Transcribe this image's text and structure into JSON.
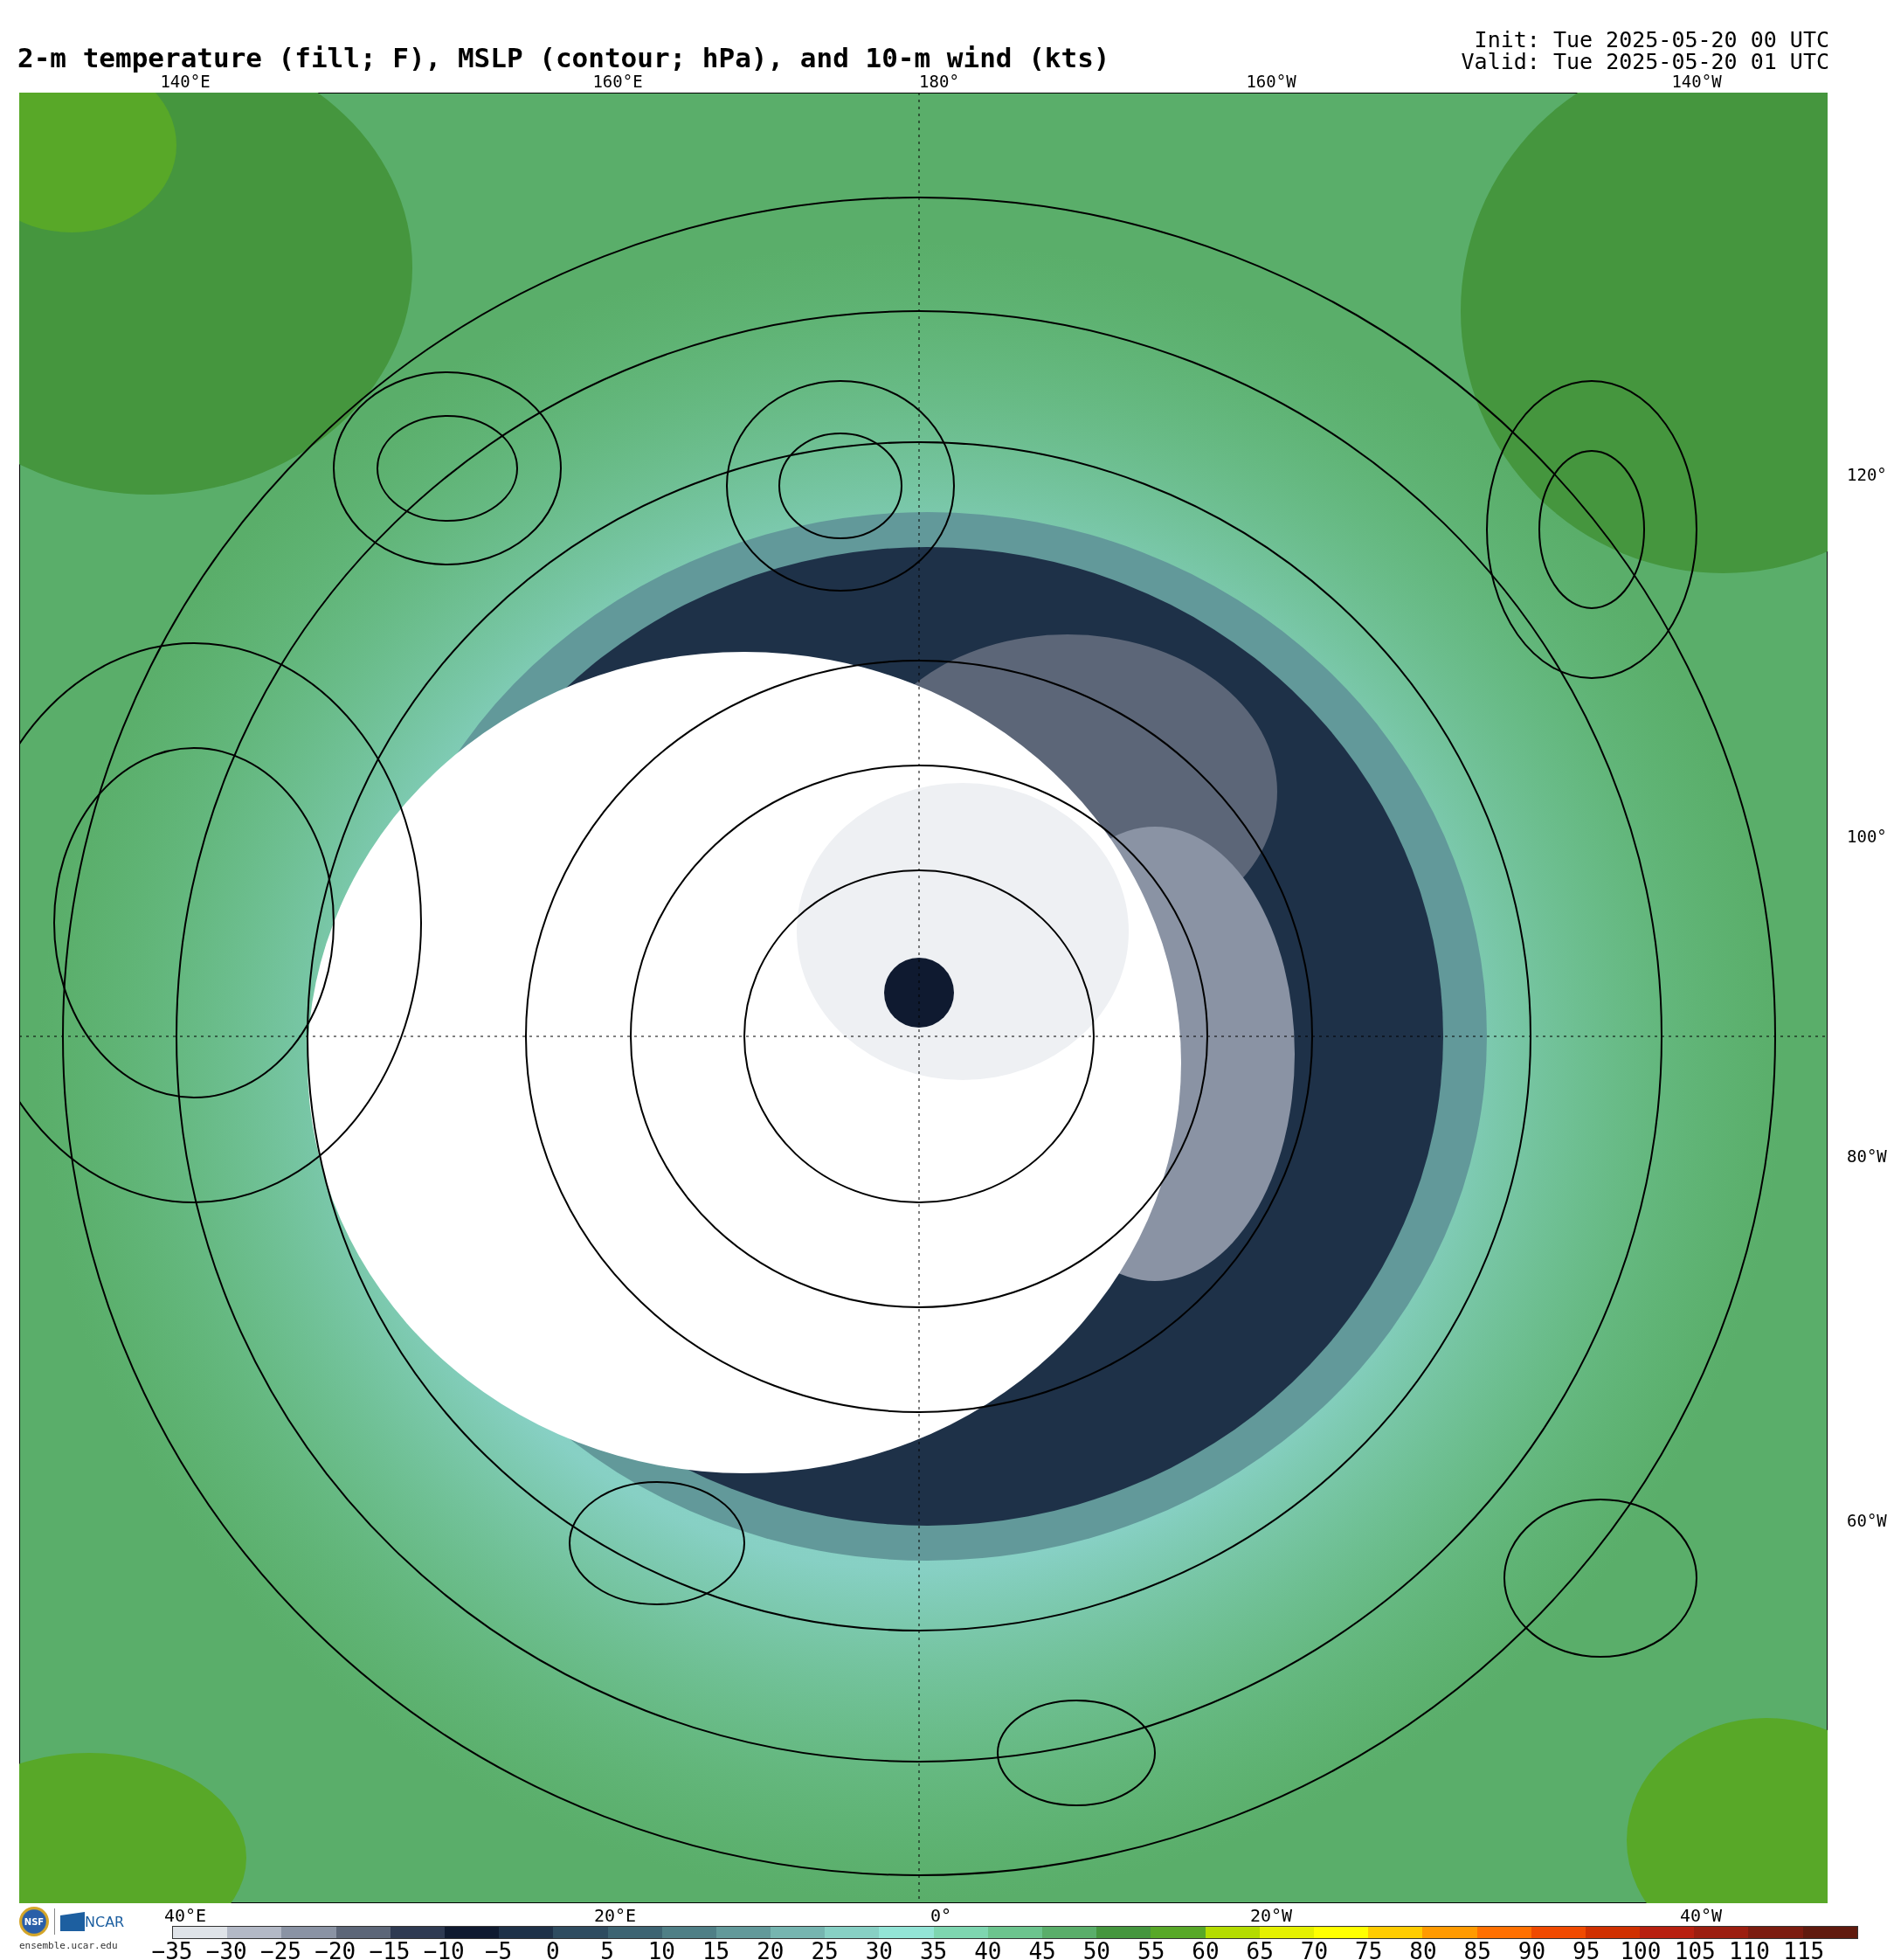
{
  "header": {
    "title": "2-m temperature (fill; F), MSLP (contour; hPa), and 10-m wind (kts)",
    "init": "Init: Tue 2025-05-20 00 UTC",
    "valid": "Valid: Tue 2025-05-20 01 UTC"
  },
  "map": {
    "lon_labels_top": [
      "140°E",
      "160°E",
      "180°",
      "160°W",
      "140°W"
    ],
    "lat_labels_right": [
      "120°",
      "100°",
      "80°W",
      "60°W"
    ],
    "lon_labels_bottom": [
      "40°E",
      "20°E",
      "0°",
      "20°W",
      "40°W"
    ]
  },
  "colorbar": {
    "bins": [
      {
        "color": "#dfe3e8"
      },
      {
        "color": "#b3b9c6"
      },
      {
        "color": "#8a93a4"
      },
      {
        "color": "#5c6678"
      },
      {
        "color": "#2e3a52"
      },
      {
        "color": "#0f1a30"
      },
      {
        "color": "#1e3148"
      },
      {
        "color": "#2e4c60"
      },
      {
        "color": "#3d6472"
      },
      {
        "color": "#4f7f86"
      },
      {
        "color": "#62999a"
      },
      {
        "color": "#76b5b0"
      },
      {
        "color": "#87d0c4"
      },
      {
        "color": "#93e4d6"
      },
      {
        "color": "#7ed6b0"
      },
      {
        "color": "#6cc48e"
      },
      {
        "color": "#5aae6a"
      },
      {
        "color": "#45963e"
      },
      {
        "color": "#58a828"
      },
      {
        "color": "#b4dc00"
      },
      {
        "color": "#e4f000"
      },
      {
        "color": "#ffff00"
      },
      {
        "color": "#ffcc00"
      },
      {
        "color": "#ff9a00"
      },
      {
        "color": "#ff7000"
      },
      {
        "color": "#f04a00"
      },
      {
        "color": "#d03000"
      },
      {
        "color": "#b82010"
      },
      {
        "color": "#9c1e10"
      },
      {
        "color": "#7c1c10"
      },
      {
        "color": "#601a0e"
      }
    ],
    "tick_labels": [
      "−35",
      "−30",
      "−25",
      "−20",
      "−15",
      "−10",
      "−5",
      "0",
      "5",
      "10",
      "15",
      "20",
      "25",
      "30",
      "35",
      "40",
      "45",
      "50",
      "55",
      "60",
      "65",
      "70",
      "75",
      "80",
      "85",
      "90",
      "95",
      "100",
      "105",
      "110",
      "115"
    ]
  },
  "footer": {
    "logo_text": "NSF",
    "org": "NCAR",
    "url": "ensemble.ucar.edu"
  }
}
